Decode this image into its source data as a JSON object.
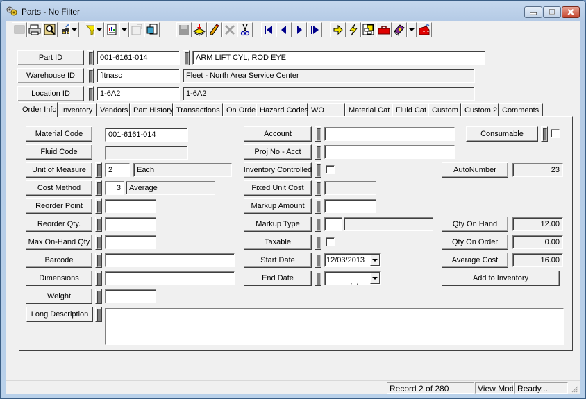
{
  "window": {
    "title": "Parts - No Filter",
    "controls": {
      "minimize": "minimize",
      "maximize": "maximize",
      "close": "close"
    }
  },
  "toolbar": {
    "buttons": [
      {
        "icon": "form-view-icon",
        "enabled": false
      },
      {
        "icon": "print-icon",
        "enabled": true
      },
      {
        "icon": "print-preview-icon",
        "enabled": true
      },
      {
        "icon": "find-icon",
        "enabled": true,
        "dropdown": true
      },
      {
        "icon": "filter-icon",
        "enabled": true,
        "dropdown": true
      },
      {
        "icon": "report-icon",
        "enabled": true,
        "dropdown": true
      },
      {
        "icon": "properties-icon",
        "enabled": false
      },
      {
        "icon": "copy-record-icon",
        "enabled": true
      },
      {
        "icon": "save-icon",
        "enabled": false
      },
      {
        "icon": "new-record-icon",
        "enabled": true
      },
      {
        "icon": "edit-icon",
        "enabled": true
      },
      {
        "icon": "delete-icon",
        "enabled": false
      },
      {
        "icon": "cut-icon",
        "enabled": true
      },
      {
        "icon": "first-record-icon",
        "enabled": true
      },
      {
        "icon": "previous-record-icon",
        "enabled": true
      },
      {
        "icon": "next-record-icon",
        "enabled": true
      },
      {
        "icon": "last-record-icon",
        "enabled": true
      },
      {
        "icon": "goto-icon",
        "enabled": true
      },
      {
        "icon": "quick-action-icon",
        "enabled": true
      },
      {
        "icon": "diagram-icon",
        "enabled": true
      },
      {
        "icon": "toolbox-icon",
        "enabled": true
      },
      {
        "icon": "help-book-icon",
        "enabled": true,
        "dropdown": true
      },
      {
        "icon": "exit-icon",
        "enabled": true
      }
    ]
  },
  "header": {
    "part_id": {
      "label": "Part ID",
      "value": "001-6161-014",
      "description": "ARM LIFT CYL, ROD EYE"
    },
    "warehouse_id": {
      "label": "Warehouse ID",
      "value": "fltnasc",
      "description": "Fleet - North Area Service Center"
    },
    "location_id": {
      "label": "Location ID",
      "value": "1-6A2",
      "description": "1-6A2"
    }
  },
  "tabs": [
    {
      "label": "Order Info",
      "active": true
    },
    {
      "label": "Inventory"
    },
    {
      "label": "Vendors"
    },
    {
      "label": "Part History"
    },
    {
      "label": "Transactions"
    },
    {
      "label": "On Order"
    },
    {
      "label": "Hazard Codes"
    },
    {
      "label": "WO"
    },
    {
      "label": "Material Cat"
    },
    {
      "label": "Fluid Cat"
    },
    {
      "label": "Custom"
    },
    {
      "label": "Custom 2"
    },
    {
      "label": "Comments"
    }
  ],
  "order_info": {
    "material_code": {
      "label": "Material Code",
      "value": "001-6161-014"
    },
    "fluid_code": {
      "label": "Fluid Code",
      "value": ""
    },
    "unit_of_measure": {
      "label": "Unit of Measure",
      "code": "2",
      "description": "Each"
    },
    "cost_method": {
      "label": "Cost Method",
      "code": "3",
      "description": "Average"
    },
    "reorder_point": {
      "label": "Reorder Point",
      "value": ""
    },
    "reorder_qty": {
      "label": "Reorder Qty.",
      "value": ""
    },
    "max_on_hand_qty": {
      "label": "Max On-Hand Qty",
      "value": ""
    },
    "barcode": {
      "label": "Barcode",
      "value": ""
    },
    "dimensions": {
      "label": "Dimensions",
      "value": ""
    },
    "weight": {
      "label": "Weight",
      "value": ""
    },
    "long_description": {
      "label": "Long Description",
      "value": ""
    },
    "account": {
      "label": "Account",
      "value": ""
    },
    "proj_no_acct": {
      "label": "Proj No - Acct",
      "value": ""
    },
    "inventory_controlled": {
      "label": "Inventory Controlled",
      "checked": false
    },
    "fixed_unit_cost": {
      "label": "Fixed Unit Cost",
      "value": ""
    },
    "markup_amount": {
      "label": "Markup Amount",
      "value": ""
    },
    "markup_type": {
      "label": "Markup Type",
      "code": "",
      "description": ""
    },
    "taxable": {
      "label": "Taxable",
      "checked": false
    },
    "start_date": {
      "label": "Start Date",
      "value": "12/03/2013"
    },
    "end_date": {
      "label": "End Date",
      "value": " /  /"
    },
    "consumable": {
      "label": "Consumable",
      "checked": false
    },
    "autonumber": {
      "label": "AutoNumber",
      "value": "23"
    },
    "qty_on_hand": {
      "label": "Qty On Hand",
      "value": "12.00"
    },
    "qty_on_order": {
      "label": "Qty On Order",
      "value": "0.00"
    },
    "average_cost": {
      "label": "Average Cost",
      "value": "16.00"
    },
    "add_to_inventory": {
      "label": "Add to Inventory"
    }
  },
  "status": {
    "record": "Record 2 of 280",
    "mode": "View Mode",
    "state": "Ready..."
  }
}
